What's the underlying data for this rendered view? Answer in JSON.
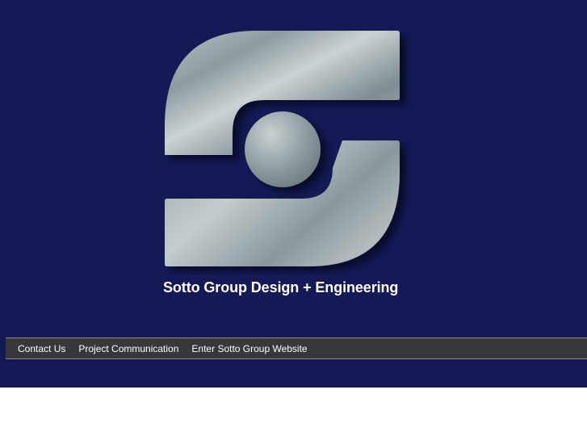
{
  "page": {
    "background_color": "#141a56",
    "lower_background_color": "#ffffff"
  },
  "brand": {
    "logo_icon": "metal-s-logo-icon",
    "tagline": "Sotto Group Design + Engineering"
  },
  "nav": {
    "background_color": "#383838",
    "items": [
      {
        "label": "Contact Us"
      },
      {
        "label": "Project Communication"
      },
      {
        "label": "Enter Sotto Group Website"
      }
    ]
  }
}
